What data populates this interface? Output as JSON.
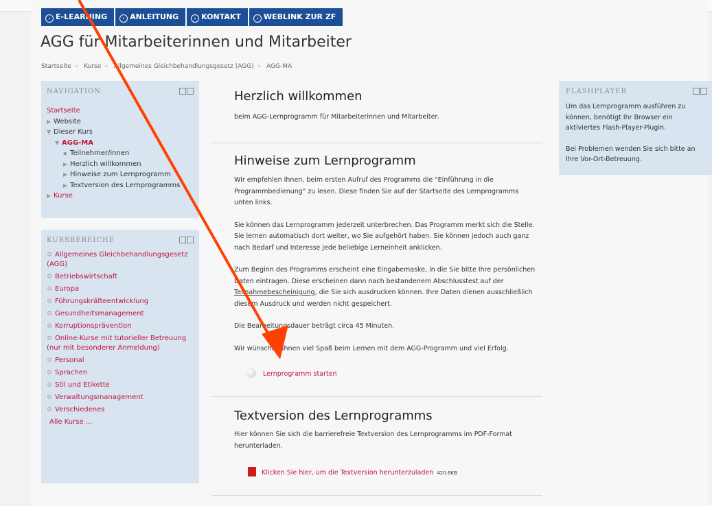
{
  "nav_tabs": [
    "E-LEARNING",
    "ANLEITUNG",
    "KONTAKT",
    "WEBLINK ZUR ZF"
  ],
  "page_title": "AGG für Mitarbeiterinnen und Mitarbeiter",
  "breadcrumb": [
    "Startseite",
    "Kurse",
    "Allgemeines Gleichbehandlungsgesetz (AGG)",
    "AGG-MA"
  ],
  "navigation": {
    "heading": "NAVIGATION",
    "home": "Startseite",
    "website": "Website",
    "dieser_kurs": "Dieser Kurs",
    "current_course": "AGG-MA",
    "participants": "Teilnehmer/innen",
    "welcome": "Herzlich willkommen",
    "hints": "Hinweise zum Lernprogramm",
    "textversion": "Textversion des Lernprogramms",
    "courses": "Kurse"
  },
  "kursbereiche": {
    "heading": "KURSBEREICHE",
    "items": [
      "Allgemeines Gleichbehandlungsgesetz (AGG)",
      "Betriebswirtschaft",
      "Europa",
      "Führungskräfteentwicklung",
      "Gesundheitsmanagement",
      "Korruptionsprävention",
      "Online-Kurse mit tutorieller Betreuung (nur mit besonderer Anmeldung)",
      "Personal",
      "Sprachen",
      "Stil und Etikette",
      "Verwaltungsmanagement",
      "Verschiedenes"
    ],
    "all_courses": "Alle Kurse ..."
  },
  "flashplayer": {
    "heading": "FLASHPLAYER",
    "text1": "Um das Lernprogramm ausführen zu können, benötigt Ihr Browser ein aktiviertes Flash-Player-Plugin.",
    "text2": "Bei Problemen wenden Sie sich bitte an Ihre Vor-Ort-Betreuung."
  },
  "welcome": {
    "heading": "Herzlich willkommen",
    "text": "beim AGG-Lernprogramm für Mitarbeiterinnen und Mitarbeiter."
  },
  "hints": {
    "heading": "Hinweise zum Lernprogramm",
    "p1": "Wir empfehlen Ihnen, beim ersten Aufruf des Programms die \"Einführung in die Programmbedienung\" zu lesen. Diese finden Sie auf der Startseite des Lernprogramms unten links.",
    "p2": "Sie können das Lernprogramm jederzeit unterbrechen. Das Programm merkt sich die Stelle. Sie lernen automatisch dort weiter, wo Sie aufgehört haben. Sie können jedoch auch ganz nach Bedarf und Interesse jede beliebige Lerneinheit anklicken.",
    "p3_a": "Zum Beginn des Programms erscheint eine Eingabemaske, in die Sie bitte Ihre persönlichen Daten eintragen. Diese erscheinen dann nach bestandenem Abschlusstest auf der ",
    "p3_link": "Teilnahmebescheinigung",
    "p3_b": ", die Sie sich ausdrucken können. Ihre Daten dienen ausschließlich diesem Ausdruck und werden nicht gespeichert.",
    "p4": "Die Bearbeitungsdauer beträgt circa 45 Minuten.",
    "p5": "Wir wünschen Ihnen viel Spaß beim Lernen mit dem AGG-Programm und viel Erfolg.",
    "start_link": "Lernprogramm starten"
  },
  "textversion": {
    "heading": "Textversion des Lernprogramms",
    "text": "Hier können Sie sich die barrierefreie Textversion des Lernprogramms im PDF-Format herunterladen.",
    "download_link": "Klicken Sie hier, um die Textversion herunterzuladen",
    "size": "420.6KB"
  },
  "colors": {
    "accent": "#c0143c",
    "tab_blue": "#1c4f96",
    "block_bg": "#d8e4f0",
    "annotation_arrow": "#ff4000"
  }
}
